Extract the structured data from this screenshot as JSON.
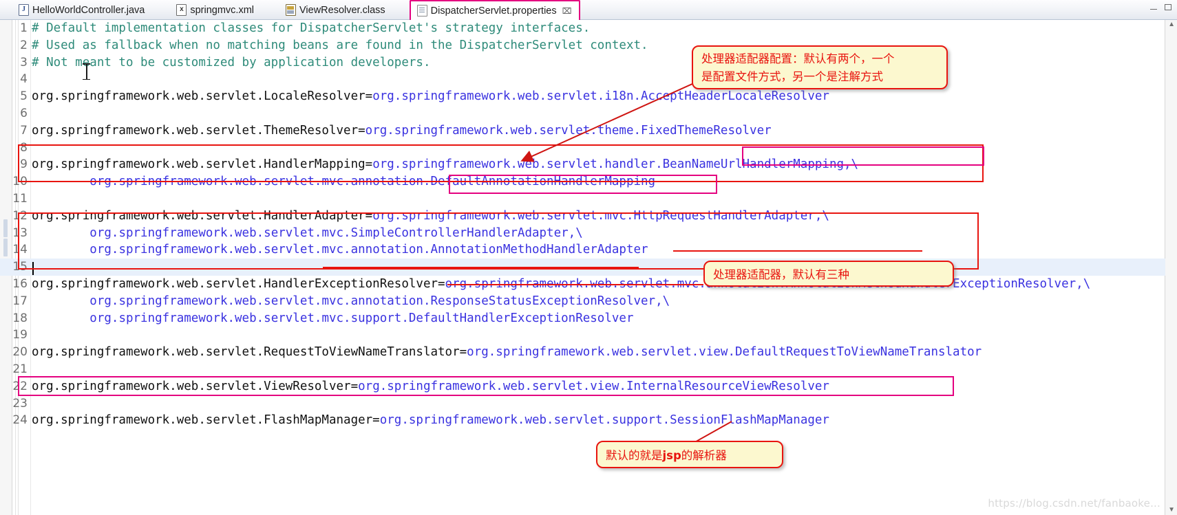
{
  "window": {
    "minimize_label": "minimize",
    "maximize_label": "maximize"
  },
  "tabs": [
    {
      "label": "HelloWorldController.java",
      "icon": "java-file-icon",
      "active": false
    },
    {
      "label": "springmvc.xml",
      "icon": "xml-file-icon",
      "active": false
    },
    {
      "label": "ViewResolver.class",
      "icon": "class-file-icon",
      "active": false
    },
    {
      "label": "DispatcherServlet.properties",
      "icon": "properties-file-icon",
      "active": true,
      "close": "⌧"
    }
  ],
  "editor": {
    "lines": [
      {
        "n": "1",
        "comment": "# Default implementation classes for DispatcherServlet's strategy interfaces.",
        "key": "",
        "value": ""
      },
      {
        "n": "2",
        "comment": "# Used as fallback when no matching beans are found in the DispatcherServlet context.",
        "key": "",
        "value": ""
      },
      {
        "n": "3",
        "comment": "# Not meant to be customized by application developers.",
        "key": "",
        "value": ""
      },
      {
        "n": "4",
        "comment": "",
        "key": "",
        "value": ""
      },
      {
        "n": "5",
        "comment": "",
        "key": "org.springframework.web.servlet.LocaleResolver=",
        "value": "org.springframework.web.servlet.i18n.AcceptHeaderLocaleResolver"
      },
      {
        "n": "6",
        "comment": "",
        "key": "",
        "value": ""
      },
      {
        "n": "7",
        "comment": "",
        "key": "org.springframework.web.servlet.ThemeResolver=",
        "value": "org.springframework.web.servlet.theme.FixedThemeResolver"
      },
      {
        "n": "8",
        "comment": "",
        "key": "",
        "value": ""
      },
      {
        "n": "9",
        "comment": "",
        "key": "org.springframework.web.servlet.HandlerMapping=",
        "value": "org.springframework.web.servlet.handler.BeanNameUrlHandlerMapping,\\"
      },
      {
        "n": "10",
        "comment": "",
        "key": "",
        "value": "\torg.springframework.web.servlet.mvc.annotation.DefaultAnnotationHandlerMapping"
      },
      {
        "n": "11",
        "comment": "",
        "key": "",
        "value": ""
      },
      {
        "n": "12",
        "comment": "",
        "key": "org.springframework.web.servlet.HandlerAdapter=",
        "value": "org.springframework.web.servlet.mvc.HttpRequestHandlerAdapter,\\"
      },
      {
        "n": "13",
        "comment": "",
        "key": "",
        "value": "\torg.springframework.web.servlet.mvc.SimpleControllerHandlerAdapter,\\"
      },
      {
        "n": "14",
        "comment": "",
        "key": "",
        "value": "\torg.springframework.web.servlet.mvc.annotation.AnnotationMethodHandlerAdapter"
      },
      {
        "n": "15",
        "comment": "",
        "key": "",
        "value": "",
        "current": true
      },
      {
        "n": "16",
        "comment": "",
        "key": "org.springframework.web.servlet.HandlerExceptionResolver=",
        "value": "org.springframework.web.servlet.mvc.annotation.AnnotationMethodHandlerExceptionResolver,\\"
      },
      {
        "n": "17",
        "comment": "",
        "key": "",
        "value": "\torg.springframework.web.servlet.mvc.annotation.ResponseStatusExceptionResolver,\\"
      },
      {
        "n": "18",
        "comment": "",
        "key": "",
        "value": "\torg.springframework.web.servlet.mvc.support.DefaultHandlerExceptionResolver"
      },
      {
        "n": "19",
        "comment": "",
        "key": "",
        "value": ""
      },
      {
        "n": "20",
        "comment": "",
        "key": "org.springframework.web.servlet.RequestToViewNameTranslator=",
        "value": "org.springframework.web.servlet.view.DefaultRequestToViewNameTranslator"
      },
      {
        "n": "21",
        "comment": "",
        "key": "",
        "value": ""
      },
      {
        "n": "22",
        "comment": "",
        "key": "org.springframework.web.servlet.ViewResolver=",
        "value": "org.springframework.web.servlet.view.InternalResourceViewResolver"
      },
      {
        "n": "23",
        "comment": "",
        "key": "",
        "value": ""
      },
      {
        "n": "24",
        "comment": "",
        "key": "org.springframework.web.servlet.FlashMapManager=",
        "value": "org.springframework.web.servlet.support.SessionFlashMapManager"
      }
    ]
  },
  "annotations": {
    "note_handler_mapping": "处理器适配器配置：默认有两个，一个\n是配置文件方式，另一个是注解方式",
    "note_handler_adapter": "处理器适配器，默认有三种",
    "note_view_resolver_pre": "默认的就是",
    "note_view_resolver_em": "jsp",
    "note_view_resolver_post": "的解析器"
  },
  "colors": {
    "comment": "#2e8b7a",
    "key": "#111111",
    "value": "#3a32e0",
    "highlight_red": "#e8140f",
    "highlight_magenta": "#e4007f",
    "note_bg": "#fcf8cf",
    "current_line": "#e8f0fb"
  },
  "watermark": "https://blog.csdn.net/fanbaoke..."
}
